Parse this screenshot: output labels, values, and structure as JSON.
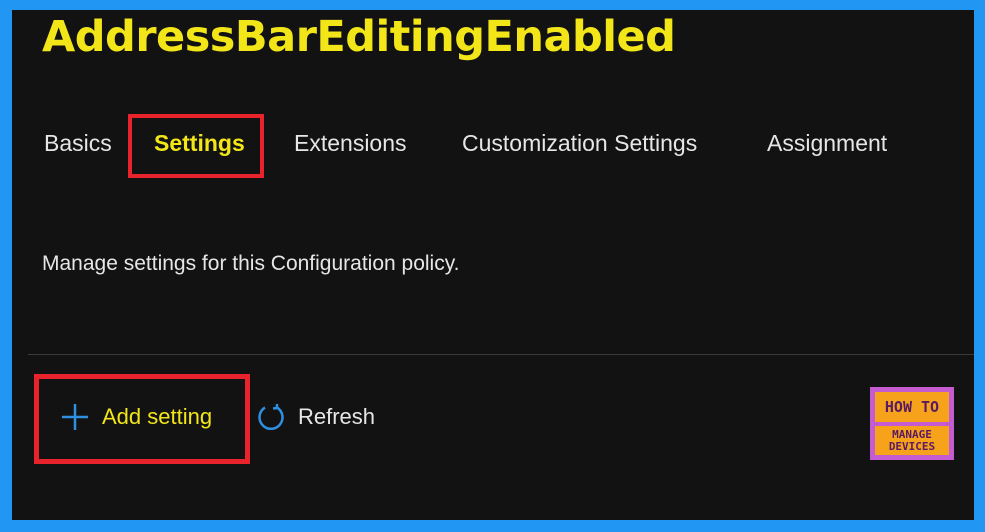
{
  "title": "AddressBarEditingEnabled",
  "tabs": [
    {
      "label": "Basics"
    },
    {
      "label": "Settings"
    },
    {
      "label": "Extensions"
    },
    {
      "label": "Customization Settings"
    },
    {
      "label": "Assignment"
    }
  ],
  "description": "Manage settings for this Configuration policy.",
  "toolbar": {
    "add_label": "Add setting",
    "add_icon": "plus-icon",
    "refresh_label": "Refresh",
    "refresh_icon": "refresh-icon"
  },
  "logo": {
    "line1": "HOW TO",
    "line2": "MANAGE",
    "line3": "DEVICES"
  },
  "colors": {
    "highlight_text": "#f2e619",
    "annotation_red": "#e8232b",
    "frame_border": "#2196f3",
    "background": "#121212"
  }
}
